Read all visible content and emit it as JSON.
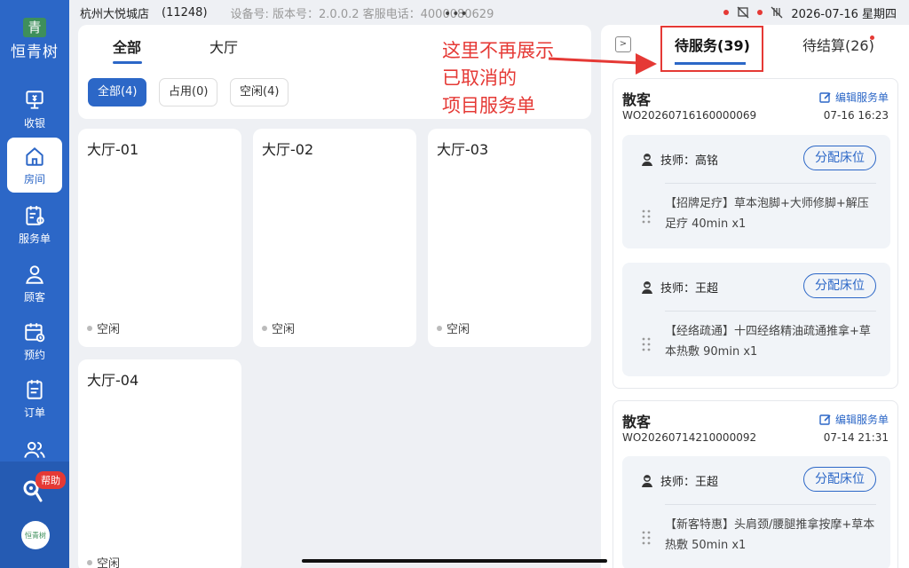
{
  "status_bar": {
    "store_name": "杭州大悦城店",
    "store_id": "(11248)",
    "device_info": "设备号:  版本号：2.0.0.2  客服电话：4000080629",
    "datetime": "2026-07-16 星期四"
  },
  "sidebar": {
    "logo_mark": "青",
    "logo_name": "恒青树",
    "items": [
      {
        "label": "收银",
        "icon": "cashier-icon"
      },
      {
        "label": "房间",
        "icon": "home-icon"
      },
      {
        "label": "服务单",
        "icon": "service-order-icon"
      },
      {
        "label": "顾客",
        "icon": "customer-icon"
      },
      {
        "label": "预约",
        "icon": "calendar-icon"
      },
      {
        "label": "订单",
        "icon": "order-icon"
      },
      {
        "label": "",
        "icon": "group-icon"
      }
    ],
    "help_label": "帮助",
    "bottom_logo": "恒青树"
  },
  "rooms_panel": {
    "tabs": [
      "全部",
      "大厅"
    ],
    "filters": [
      "全部(4)",
      "占用(0)",
      "空闲(4)"
    ],
    "rooms": [
      {
        "name": "大厅-01",
        "status": "空闲"
      },
      {
        "name": "大厅-02",
        "status": "空闲"
      },
      {
        "name": "大厅-03",
        "status": "空闲"
      },
      {
        "name": "大厅-04",
        "status": "空闲"
      }
    ]
  },
  "annotation": {
    "lines": [
      "这里不再展示",
      "已取消的",
      "项目服务单"
    ],
    "color": "#e53935"
  },
  "orders_panel": {
    "collapse_glyph": ">",
    "tabs": [
      "待服务(39)",
      "待结算(26)"
    ],
    "cards": [
      {
        "title": "散客",
        "edit_label": "编辑服务单",
        "order_no": "WO20260716160000069",
        "time": "07-16 16:23",
        "services": [
          {
            "tech": "技师：高铭",
            "button": "分配床位",
            "desc": "【招牌足疗】草本泡脚+大师修脚+解压足疗 40min x1"
          },
          {
            "tech": "技师：王超",
            "button": "分配床位",
            "desc": "【经络疏通】十四经络精油疏通推拿+草本热敷 90min x1"
          }
        ]
      },
      {
        "title": "散客",
        "edit_label": "编辑服务单",
        "order_no": "WO20260714210000092",
        "time": "07-14 21:31",
        "services": [
          {
            "tech": "技师：王超",
            "button": "分配床位",
            "desc": "【新客特惠】头肩颈/腰腿推拿按摩+草本热敷 50min x1"
          }
        ]
      }
    ]
  },
  "colors": {
    "primary": "#2c67c7",
    "accent_red": "#e53935",
    "background": "#eef0f4"
  }
}
